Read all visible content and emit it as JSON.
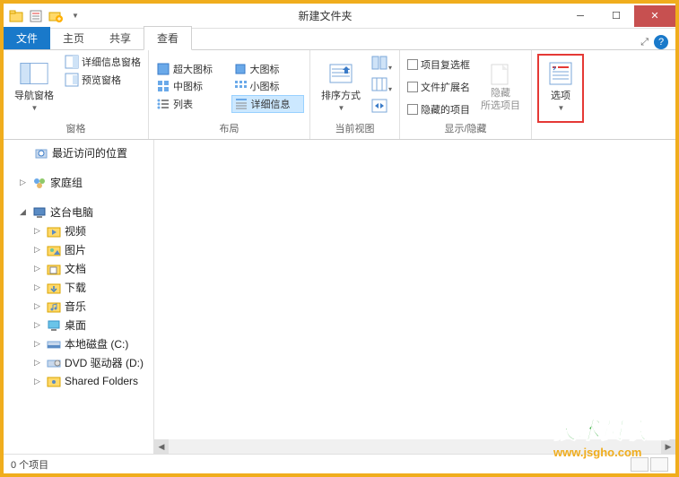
{
  "window": {
    "title": "新建文件夹"
  },
  "tabs": {
    "file": "文件",
    "home": "主页",
    "share": "共享",
    "view": "查看"
  },
  "ribbon": {
    "panes": {
      "label": "窗格",
      "nav_pane": "导航窗格",
      "preview_pane": "预览窗格",
      "details_pane": "详细信息窗格"
    },
    "layout": {
      "label": "布局",
      "extra_large": "超大图标",
      "large": "大图标",
      "medium": "中图标",
      "small": "小图标",
      "list": "列表",
      "details": "详细信息"
    },
    "current_view": {
      "label": "当前视图",
      "sort": "排序方式"
    },
    "show_hide": {
      "label": "显示/隐藏",
      "checkboxes": "项目复选框",
      "extensions": "文件扩展名",
      "hidden_items": "隐藏的项目",
      "hide_selected": "隐藏\n所选项目"
    },
    "options": "选项"
  },
  "tree": {
    "recent": "最近访问的位置",
    "homegroup": "家庭组",
    "this_pc": "这台电脑",
    "videos": "视频",
    "pictures": "图片",
    "documents": "文档",
    "downloads": "下载",
    "music": "音乐",
    "desktop": "桌面",
    "local_disk": "本地磁盘 (C:)",
    "dvd": "DVD 驱动器 (D:)",
    "shared": "Shared Folders"
  },
  "status": {
    "items": "0 个项目"
  },
  "watermark": {
    "line1": "技术员联盟",
    "line2": "www.jsgho.com"
  }
}
